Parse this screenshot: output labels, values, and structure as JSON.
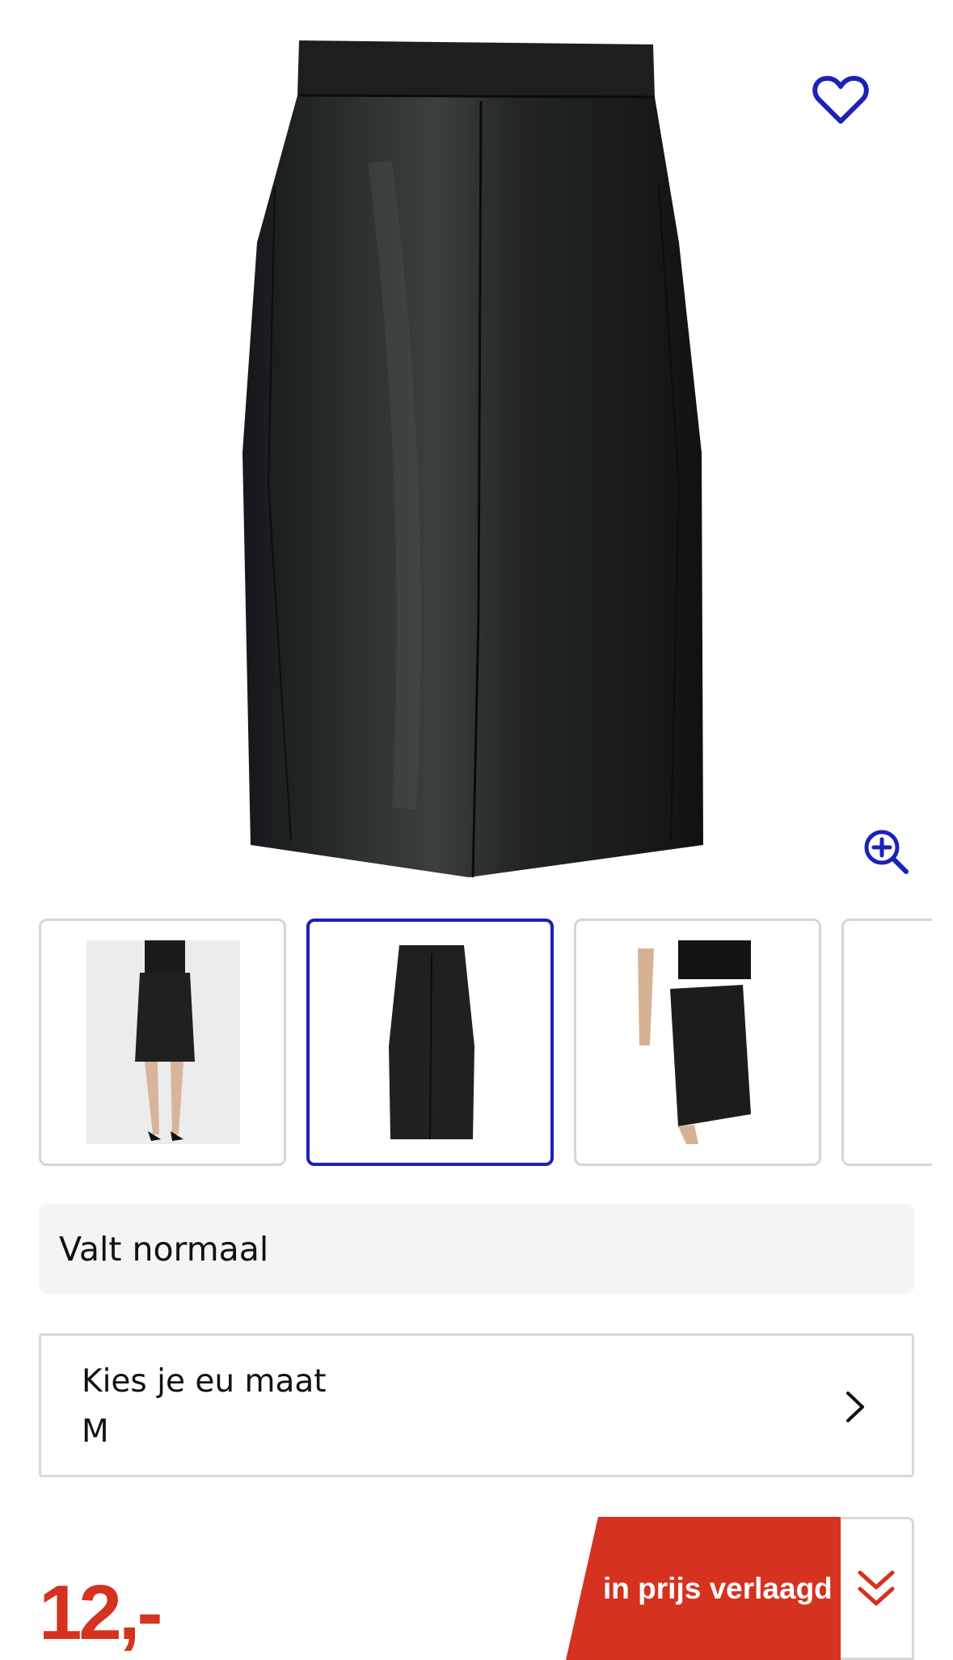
{
  "product": {
    "image_alt": "black faux leather pencil skirt",
    "favorite_icon": "heart-outline-icon",
    "zoom_icon": "zoom-in-icon"
  },
  "thumbnails": [
    {
      "name": "model-front-view",
      "selected": false
    },
    {
      "name": "skirt-flat-view",
      "selected": true
    },
    {
      "name": "model-side-view",
      "selected": false
    },
    {
      "name": "partial-view",
      "selected": false
    }
  ],
  "fit_note": "Valt normaal",
  "size_picker": {
    "label": "Kies je eu maat",
    "value": "M"
  },
  "price": {
    "amount": "12,-"
  },
  "promo": {
    "label": "in prijs verlaagd"
  },
  "colors": {
    "accent_blue": "#1a22b8",
    "price_red": "#d5321f",
    "promo_red": "#d5321f"
  }
}
